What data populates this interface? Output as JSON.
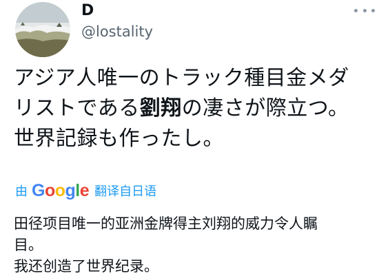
{
  "user": {
    "display_name": "D",
    "handle": "@lostality"
  },
  "menu": {
    "icon": "more-horizontal-icon"
  },
  "tweet": {
    "line1": "アジア人唯一のトラック種目金メダ",
    "line2_prefix": "リストである",
    "line2_bold": "劉翔",
    "line2_suffix": "の凄さが際立つ。",
    "line3": "世界記録も作ったし。"
  },
  "translate": {
    "by_label": "由",
    "logo_letters": [
      "G",
      "o",
      "o",
      "g",
      "l",
      "e"
    ],
    "logo_colors": [
      "#4285F4",
      "#EA4335",
      "#FBBC05",
      "#4285F4",
      "#34A853",
      "#EA4335"
    ],
    "label": "翻译自日语"
  },
  "translation": {
    "line1": "田径项目唯一的亚洲金牌得主刘翔的威力令人瞩",
    "line2": "目。",
    "line3": "我还创造了世界纪录。"
  },
  "colors": {
    "link_blue": "#1d9bf0",
    "secondary_text": "#566470",
    "primary_text": "#0f1419"
  }
}
